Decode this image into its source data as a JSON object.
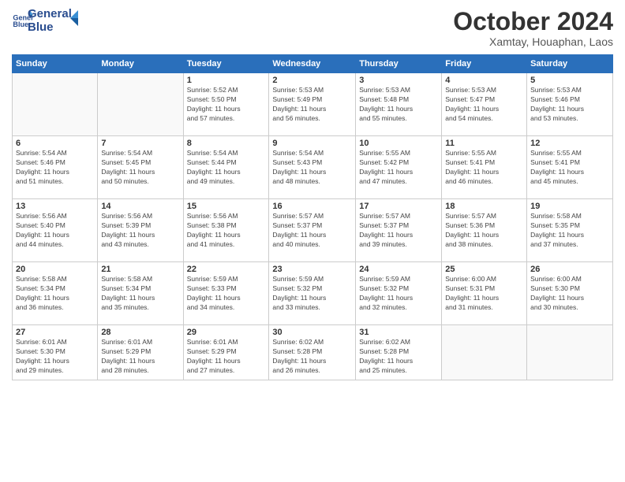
{
  "logo": {
    "line1": "General",
    "line2": "Blue"
  },
  "title": "October 2024",
  "location": "Xamtay, Houaphan, Laos",
  "header_days": [
    "Sunday",
    "Monday",
    "Tuesday",
    "Wednesday",
    "Thursday",
    "Friday",
    "Saturday"
  ],
  "weeks": [
    [
      {
        "day": "",
        "info": ""
      },
      {
        "day": "",
        "info": ""
      },
      {
        "day": "1",
        "info": "Sunrise: 5:52 AM\nSunset: 5:50 PM\nDaylight: 11 hours\nand 57 minutes."
      },
      {
        "day": "2",
        "info": "Sunrise: 5:53 AM\nSunset: 5:49 PM\nDaylight: 11 hours\nand 56 minutes."
      },
      {
        "day": "3",
        "info": "Sunrise: 5:53 AM\nSunset: 5:48 PM\nDaylight: 11 hours\nand 55 minutes."
      },
      {
        "day": "4",
        "info": "Sunrise: 5:53 AM\nSunset: 5:47 PM\nDaylight: 11 hours\nand 54 minutes."
      },
      {
        "day": "5",
        "info": "Sunrise: 5:53 AM\nSunset: 5:46 PM\nDaylight: 11 hours\nand 53 minutes."
      }
    ],
    [
      {
        "day": "6",
        "info": "Sunrise: 5:54 AM\nSunset: 5:46 PM\nDaylight: 11 hours\nand 51 minutes."
      },
      {
        "day": "7",
        "info": "Sunrise: 5:54 AM\nSunset: 5:45 PM\nDaylight: 11 hours\nand 50 minutes."
      },
      {
        "day": "8",
        "info": "Sunrise: 5:54 AM\nSunset: 5:44 PM\nDaylight: 11 hours\nand 49 minutes."
      },
      {
        "day": "9",
        "info": "Sunrise: 5:54 AM\nSunset: 5:43 PM\nDaylight: 11 hours\nand 48 minutes."
      },
      {
        "day": "10",
        "info": "Sunrise: 5:55 AM\nSunset: 5:42 PM\nDaylight: 11 hours\nand 47 minutes."
      },
      {
        "day": "11",
        "info": "Sunrise: 5:55 AM\nSunset: 5:41 PM\nDaylight: 11 hours\nand 46 minutes."
      },
      {
        "day": "12",
        "info": "Sunrise: 5:55 AM\nSunset: 5:41 PM\nDaylight: 11 hours\nand 45 minutes."
      }
    ],
    [
      {
        "day": "13",
        "info": "Sunrise: 5:56 AM\nSunset: 5:40 PM\nDaylight: 11 hours\nand 44 minutes."
      },
      {
        "day": "14",
        "info": "Sunrise: 5:56 AM\nSunset: 5:39 PM\nDaylight: 11 hours\nand 43 minutes."
      },
      {
        "day": "15",
        "info": "Sunrise: 5:56 AM\nSunset: 5:38 PM\nDaylight: 11 hours\nand 41 minutes."
      },
      {
        "day": "16",
        "info": "Sunrise: 5:57 AM\nSunset: 5:37 PM\nDaylight: 11 hours\nand 40 minutes."
      },
      {
        "day": "17",
        "info": "Sunrise: 5:57 AM\nSunset: 5:37 PM\nDaylight: 11 hours\nand 39 minutes."
      },
      {
        "day": "18",
        "info": "Sunrise: 5:57 AM\nSunset: 5:36 PM\nDaylight: 11 hours\nand 38 minutes."
      },
      {
        "day": "19",
        "info": "Sunrise: 5:58 AM\nSunset: 5:35 PM\nDaylight: 11 hours\nand 37 minutes."
      }
    ],
    [
      {
        "day": "20",
        "info": "Sunrise: 5:58 AM\nSunset: 5:34 PM\nDaylight: 11 hours\nand 36 minutes."
      },
      {
        "day": "21",
        "info": "Sunrise: 5:58 AM\nSunset: 5:34 PM\nDaylight: 11 hours\nand 35 minutes."
      },
      {
        "day": "22",
        "info": "Sunrise: 5:59 AM\nSunset: 5:33 PM\nDaylight: 11 hours\nand 34 minutes."
      },
      {
        "day": "23",
        "info": "Sunrise: 5:59 AM\nSunset: 5:32 PM\nDaylight: 11 hours\nand 33 minutes."
      },
      {
        "day": "24",
        "info": "Sunrise: 5:59 AM\nSunset: 5:32 PM\nDaylight: 11 hours\nand 32 minutes."
      },
      {
        "day": "25",
        "info": "Sunrise: 6:00 AM\nSunset: 5:31 PM\nDaylight: 11 hours\nand 31 minutes."
      },
      {
        "day": "26",
        "info": "Sunrise: 6:00 AM\nSunset: 5:30 PM\nDaylight: 11 hours\nand 30 minutes."
      }
    ],
    [
      {
        "day": "27",
        "info": "Sunrise: 6:01 AM\nSunset: 5:30 PM\nDaylight: 11 hours\nand 29 minutes."
      },
      {
        "day": "28",
        "info": "Sunrise: 6:01 AM\nSunset: 5:29 PM\nDaylight: 11 hours\nand 28 minutes."
      },
      {
        "day": "29",
        "info": "Sunrise: 6:01 AM\nSunset: 5:29 PM\nDaylight: 11 hours\nand 27 minutes."
      },
      {
        "day": "30",
        "info": "Sunrise: 6:02 AM\nSunset: 5:28 PM\nDaylight: 11 hours\nand 26 minutes."
      },
      {
        "day": "31",
        "info": "Sunrise: 6:02 AM\nSunset: 5:28 PM\nDaylight: 11 hours\nand 25 minutes."
      },
      {
        "day": "",
        "info": ""
      },
      {
        "day": "",
        "info": ""
      }
    ]
  ]
}
